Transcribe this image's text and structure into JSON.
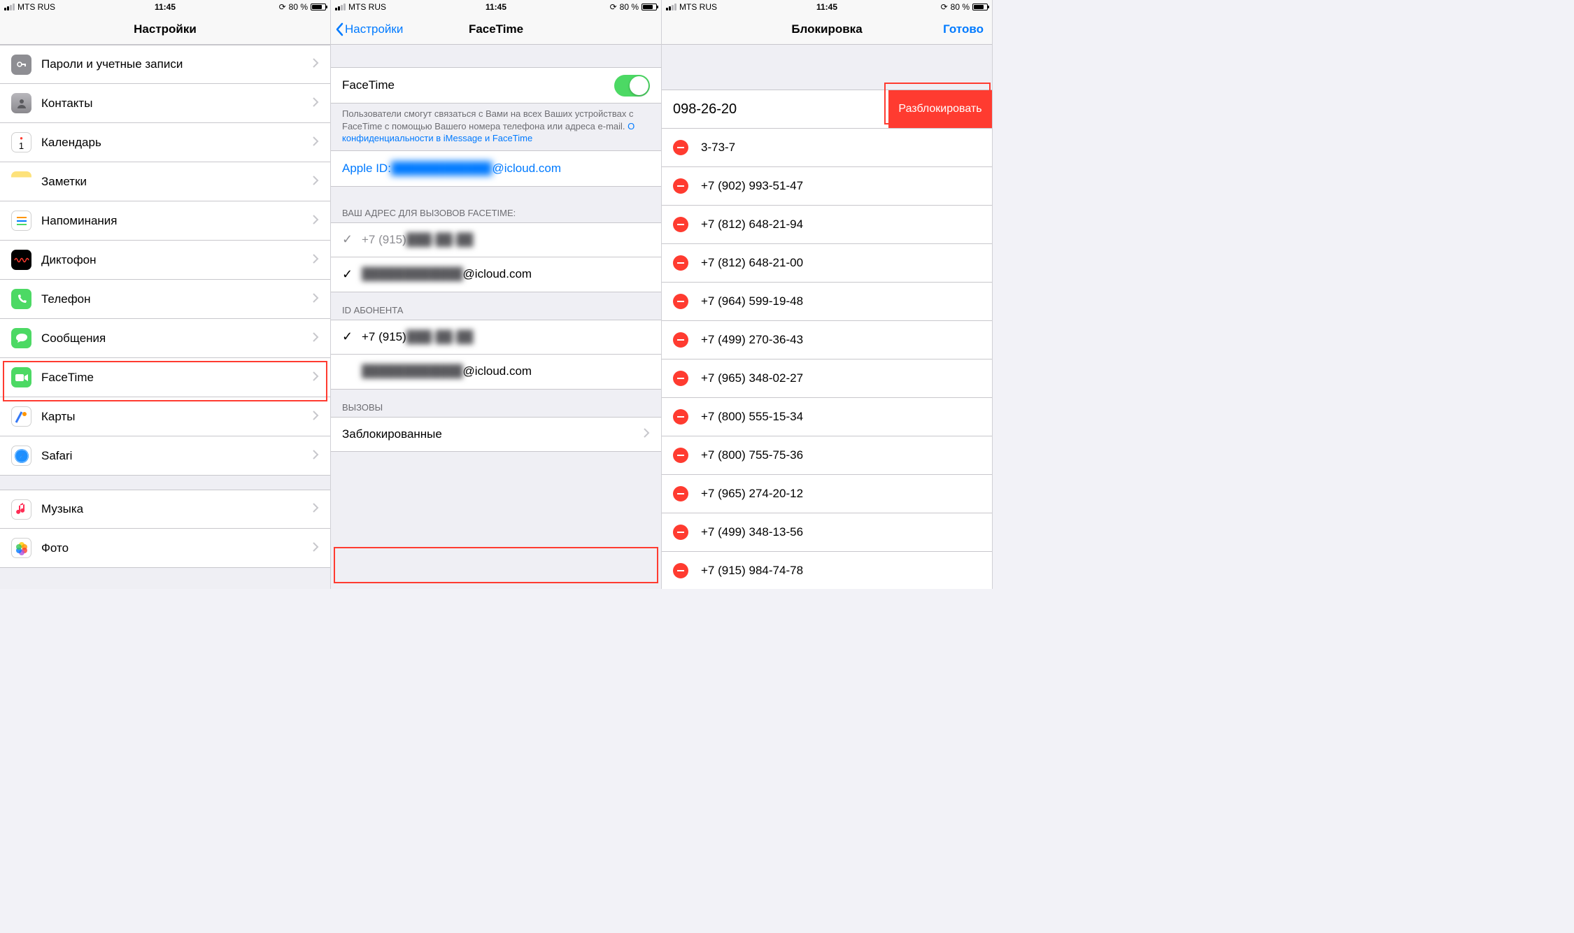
{
  "status": {
    "carrier": "MTS RUS",
    "time": "11:45",
    "battery_pct": "80 %"
  },
  "screen1": {
    "title": "Настройки",
    "items": [
      {
        "label": "Пароли и учетные записи",
        "icon": "key"
      },
      {
        "label": "Контакты",
        "icon": "contacts"
      },
      {
        "label": "Календарь",
        "icon": "cal"
      },
      {
        "label": "Заметки",
        "icon": "notes"
      },
      {
        "label": "Напоминания",
        "icon": "rem"
      },
      {
        "label": "Диктофон",
        "icon": "voice"
      },
      {
        "label": "Телефон",
        "icon": "phone"
      },
      {
        "label": "Сообщения",
        "icon": "msg"
      },
      {
        "label": "FaceTime",
        "icon": "ft"
      },
      {
        "label": "Карты",
        "icon": "maps"
      },
      {
        "label": "Safari",
        "icon": "safari"
      }
    ],
    "items2": [
      {
        "label": "Музыка",
        "icon": "music"
      },
      {
        "label": "Фото",
        "icon": "photos"
      }
    ]
  },
  "screen2": {
    "back": "Настройки",
    "title": "FaceTime",
    "toggle_label": "FaceTime",
    "toggle_on": true,
    "footer_text": "Пользователи смогут связаться с Вами на всех Ваших устройствах с FaceTime с помощью Вашего номера телефона или адреса e-mail. ",
    "footer_link": "О конфиденциальности в iMessage и FaceTime",
    "apple_id_prefix": "Apple ID: ",
    "apple_id_blur": "████████████",
    "apple_id_suffix": "@icloud.com",
    "addr_header": "ВАШ АДРЕС ДЛЯ ВЫЗОВОВ FACETIME:",
    "addr_phone_prefix": "+7 (915) ",
    "addr_phone_blur": "███-██-██",
    "addr_email_blur": "████████████",
    "addr_email_suffix": "@icloud.com",
    "caller_header": "ID АБОНЕНТА",
    "caller_phone_prefix": "+7 (915) ",
    "caller_phone_blur": "███-██-██",
    "caller_email_blur": "████████████",
    "caller_email_suffix": "@icloud.com",
    "calls_header": "ВЫЗОВЫ",
    "blocked_label": "Заблокированные"
  },
  "screen3": {
    "title": "Блокировка",
    "done": "Готово",
    "unblock_label": "Разблокировать",
    "first_number": "098-26-20",
    "numbers": [
      "3-73-7",
      "+7 (902) 993-51-47",
      "+7 (812) 648-21-94",
      "+7 (812) 648-21-00",
      "+7 (964) 599-19-48",
      "+7 (499) 270-36-43",
      "+7 (965) 348-02-27",
      "+7 (800) 555-15-34",
      "+7 (800) 755-75-36",
      "+7 (965) 274-20-12",
      "+7 (499) 348-13-56",
      "+7 (915) 984-74-78"
    ]
  }
}
